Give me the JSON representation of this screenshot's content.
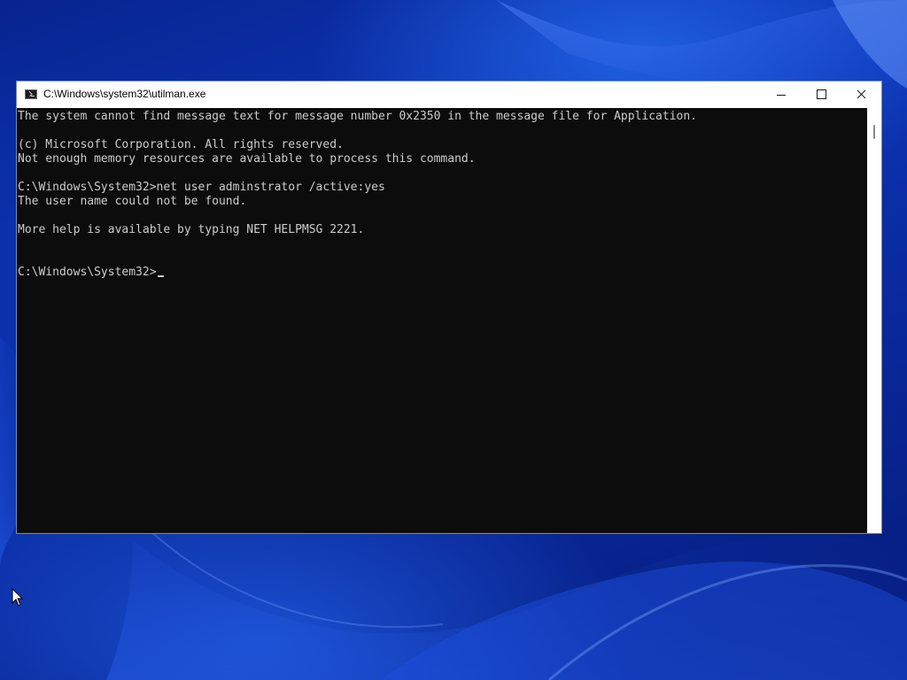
{
  "window": {
    "title": "C:\\Windows\\system32\\utilman.exe",
    "icon": "cmd-prompt-icon"
  },
  "window_controls": {
    "minimize_icon": "minimize-icon",
    "maximize_icon": "maximize-icon",
    "close_icon": "close-icon"
  },
  "console": {
    "lines": [
      "The system cannot find message text for message number 0x2350 in the message file for Application.",
      "",
      "(c) Microsoft Corporation. All rights reserved.",
      "Not enough memory resources are available to process this command.",
      "",
      "C:\\Windows\\System32>net user adminstrator /active:yes",
      "The user name could not be found.",
      "",
      "More help is available by typing NET HELPMSG 2221.",
      "",
      ""
    ],
    "prompt": "C:\\Windows\\System32>",
    "input_value": ""
  },
  "colors": {
    "console_background": "#0c0c0c",
    "console_text": "#cccccc",
    "titlebar_background": "#ffffff",
    "desktop_accent": "#0d36b8"
  }
}
